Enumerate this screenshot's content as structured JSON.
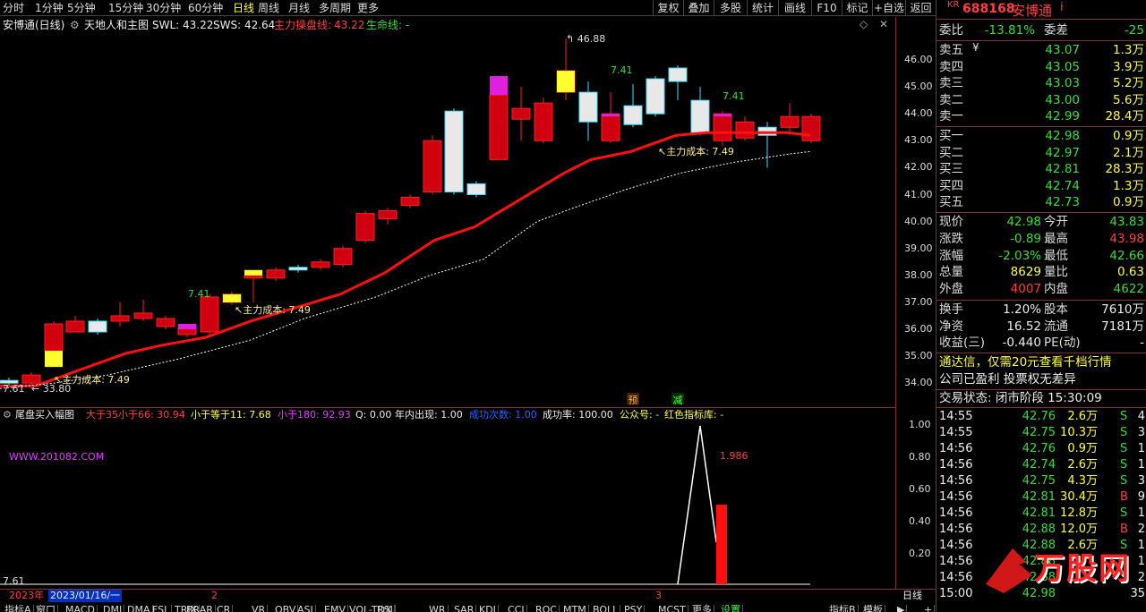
{
  "toolbar": {
    "periods": [
      "分时",
      "1分钟",
      "5分钟",
      "15分钟",
      "30分钟",
      "60分钟",
      "日线",
      "周线",
      "月线",
      "多周期",
      "更多"
    ],
    "active_period": "日线",
    "buttons": [
      "复权",
      "叠加",
      "多股",
      "统计",
      "画线",
      "F10",
      "标记",
      "+自选",
      "返回"
    ]
  },
  "main_header": {
    "stock": "安博通(日线)",
    "indicator": "天地人和主图",
    "swl": "SWL: 43.22",
    "sws": "SWS: 42.64",
    "zhuli_label": "主力操盘线:",
    "zhuli_value": "43.22",
    "shengming": "生命线: -"
  },
  "y_axis_main": [
    "46.00",
    "45.00",
    "44.00",
    "43.00",
    "42.00",
    "41.00",
    "40.00",
    "39.00",
    "38.00",
    "37.00",
    "36.00",
    "35.00",
    "34.00"
  ],
  "annotations": {
    "high_mark": "46.88",
    "low_mark": "33.80",
    "low_left": "7.61",
    "cost_labels": [
      "主力成本: 7.49",
      "主力成本: 7.49",
      "主力成本: 7.49"
    ],
    "num_labels": [
      "7.41",
      "7.41",
      "7.41"
    ],
    "pre_label": "预",
    "jian_label": "减"
  },
  "sub_header": {
    "title": "尾盘买入幅图",
    "p1": "大于35小于66: 30.94",
    "p2": "小于等于11: 7.68",
    "p3": "小于180: 92.93",
    "p4": "Q: 0.00",
    "p5": "年内出现: 1.00",
    "p6": "成功次数: 1.00",
    "p7": "成功率: 100.00",
    "p8": "公众号: -",
    "p9": "红色指标库: -"
  },
  "sub_chart": {
    "watermark": "WWW.201082.COM",
    "peak_label": "1.986",
    "left_val": "7.61",
    "y_labels": [
      "1.00",
      "0.80",
      "0.60",
      "0.40",
      "0.20"
    ]
  },
  "date_bar": {
    "year": "2023年",
    "date": "2023/01/16/一",
    "m2": "2",
    "m3": "3",
    "right": "日线"
  },
  "bottom_tabs": [
    "指标A",
    "窗口",
    "MACD",
    "DMI",
    "DMA",
    "FSL",
    "TRIX",
    "BRAR",
    "CR",
    "VR",
    "OBV",
    "ASI",
    "EMV",
    "VOL-TDX",
    "RSI",
    "WR",
    "SAR",
    "KDJ",
    "CCI",
    "ROC",
    "MTM",
    "BOLL",
    "PSY",
    "MCST",
    "更多",
    "设置"
  ],
  "bottom_right_tabs": [
    "指标B",
    "模板"
  ],
  "quote": {
    "code_prefix": "KR",
    "code": "688168",
    "name": "安博通",
    "info_icon": "i",
    "weibi_label": "委比",
    "weibi": "-13.81%",
    "weicha_label": "委差",
    "weicha": "-25",
    "asks": [
      {
        "label": "卖五",
        "price": "43.07",
        "vol": "1.3万"
      },
      {
        "label": "卖四",
        "price": "43.05",
        "vol": "3.9万"
      },
      {
        "label": "卖三",
        "price": "43.03",
        "vol": "5.2万"
      },
      {
        "label": "卖二",
        "price": "43.00",
        "vol": "5.6万"
      },
      {
        "label": "卖一",
        "price": "42.99",
        "vol": "28.4万"
      }
    ],
    "yen": "¥",
    "bids": [
      {
        "label": "买一",
        "price": "42.98",
        "vol": "0.9万"
      },
      {
        "label": "买二",
        "price": "42.97",
        "vol": "2.1万"
      },
      {
        "label": "买三",
        "price": "42.81",
        "vol": "28.3万"
      },
      {
        "label": "买四",
        "price": "42.74",
        "vol": "1.3万"
      },
      {
        "label": "买五",
        "price": "42.73",
        "vol": "0.9万"
      }
    ],
    "stats": [
      {
        "l1": "现价",
        "v1": "42.98",
        "c1": "green",
        "l2": "今开",
        "v2": "43.83",
        "c2": "green"
      },
      {
        "l1": "涨跌",
        "v1": "-0.89",
        "c1": "green",
        "l2": "最高",
        "v2": "43.98",
        "c2": "red"
      },
      {
        "l1": "涨幅",
        "v1": "-2.03%",
        "c1": "green",
        "l2": "最低",
        "v2": "42.66",
        "c2": "green"
      },
      {
        "l1": "总量",
        "v1": "8629",
        "c1": "yellow",
        "l2": "量比",
        "v2": "0.63",
        "c2": "yellow"
      },
      {
        "l1": "外盘",
        "v1": "4007",
        "c1": "red",
        "l2": "内盘",
        "v2": "4622",
        "c2": "green"
      }
    ],
    "stats2": [
      {
        "l1": "换手",
        "v1": "1.20%",
        "l2": "股本",
        "v2": "7610万"
      },
      {
        "l1": "净资",
        "v1": "16.52",
        "l2": "流通",
        "v2": "7181万"
      },
      {
        "l1": "收益(三)",
        "v1": "-0.440",
        "l2": "PE(动)",
        "v2": "-"
      }
    ],
    "promo": "通达信，仅需20元查看千档行情",
    "profit_line": "公司已盈利 投票权无差异",
    "trade_state": "交易状态: 闭市阶段 15:30:09",
    "ticks": [
      {
        "t": "14:55",
        "p": "42.76",
        "v": "2.6万",
        "s": "S",
        "n": "4"
      },
      {
        "t": "14:55",
        "p": "42.75",
        "v": "10.3万",
        "s": "S",
        "n": "3"
      },
      {
        "t": "14:56",
        "p": "42.76",
        "v": "0.9万",
        "s": "S",
        "n": "1"
      },
      {
        "t": "14:56",
        "p": "42.74",
        "v": "2.6万",
        "s": "S",
        "n": "1"
      },
      {
        "t": "14:56",
        "p": "42.75",
        "v": "4.3万",
        "s": "S",
        "n": "3"
      },
      {
        "t": "14:56",
        "p": "42.81",
        "v": "30.4万",
        "s": "B",
        "n": "9"
      },
      {
        "t": "14:56",
        "p": "42.81",
        "v": "12.8万",
        "s": "S",
        "n": "1"
      },
      {
        "t": "14:56",
        "p": "42.88",
        "v": "12.0万",
        "s": "B",
        "n": "2"
      },
      {
        "t": "14:56",
        "p": "42.88",
        "v": "2.6万",
        "s": "S",
        "n": "1"
      },
      {
        "t": "14:56",
        "p": "42.88",
        "v": "",
        "s": "S",
        "n": "1"
      },
      {
        "t": "14:56",
        "p": "42.88",
        "v": "",
        "s": "S",
        "n": "2"
      },
      {
        "t": "15:00",
        "p": "42.98",
        "v": "",
        "s": "",
        "n": "35"
      }
    ],
    "logo_text": "万股网"
  },
  "colors": {
    "up": "#ff2020",
    "down": "#40e0ff",
    "bg": "#000000",
    "border": "#803030"
  }
}
